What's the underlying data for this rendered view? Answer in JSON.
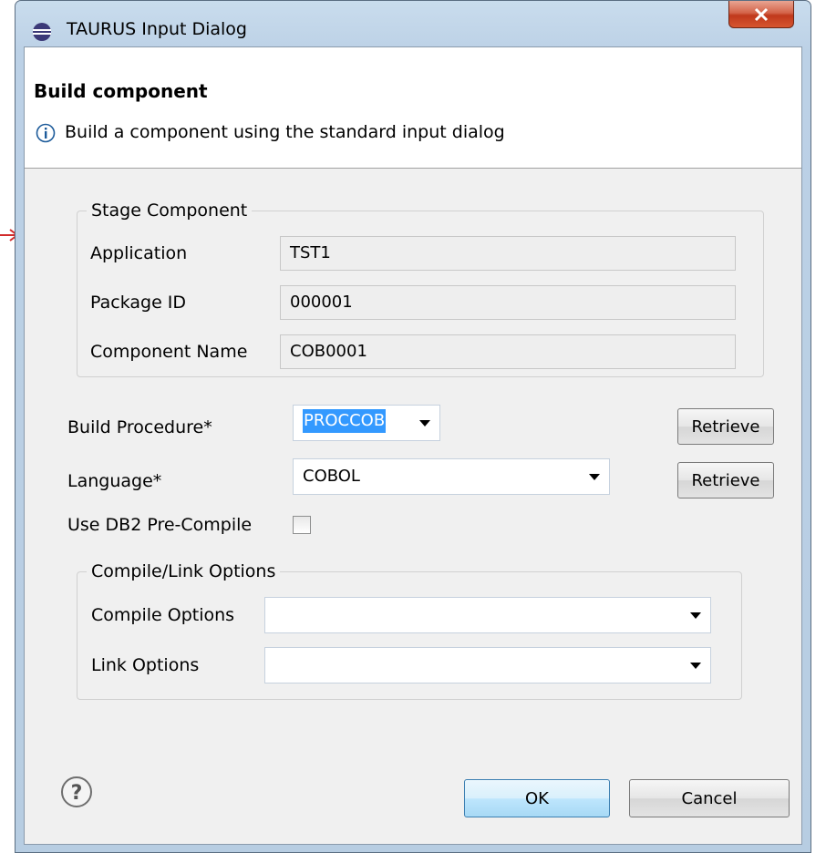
{
  "window": {
    "title": "TAURUS Input Dialog"
  },
  "header": {
    "title": "Build component",
    "message": "Build a component using the standard input dialog"
  },
  "stage_group": {
    "title": "Stage Component",
    "fields": [
      {
        "label": "Application",
        "value": "TST1"
      },
      {
        "label": "Package ID",
        "value": "000001"
      },
      {
        "label": "Component Name",
        "value": "COB0001"
      }
    ]
  },
  "build_procedure": {
    "label": "Build Procedure*",
    "value": "PROCCOB",
    "retrieve_label": "Retrieve"
  },
  "language": {
    "label": "Language*",
    "value": "COBOL",
    "retrieve_label": "Retrieve"
  },
  "db2": {
    "label": "Use DB2 Pre-Compile",
    "checked": false
  },
  "options_group": {
    "title": "Compile/Link Options",
    "compile_label": "Compile Options",
    "compile_value": "",
    "link_label": "Link Options",
    "link_value": ""
  },
  "footer": {
    "ok_label": "OK",
    "cancel_label": "Cancel"
  },
  "colors": {
    "selection": "#3399ff",
    "close_button": "#c7472a",
    "arrow": "#d22b2b"
  }
}
